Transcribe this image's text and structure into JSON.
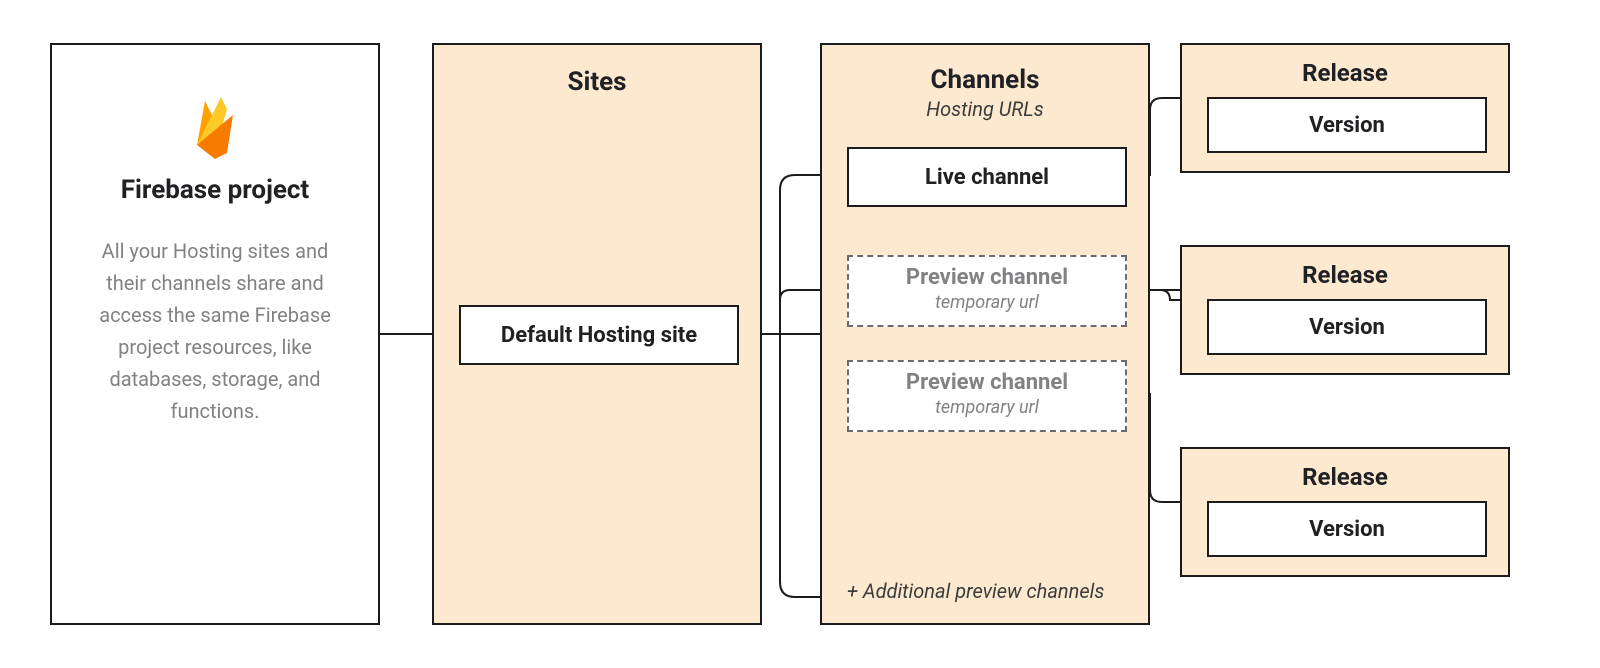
{
  "project": {
    "title": "Firebase project",
    "description": "All your Hosting sites and their channels share and access the same Firebase project resources, like databases, storage, and functions."
  },
  "sites": {
    "title": "Sites",
    "default_label": "Default Hosting site"
  },
  "channels": {
    "title": "Channels",
    "subtitle": "Hosting URLs",
    "live_label": "Live channel",
    "preview1_title": "Preview channel",
    "preview1_sub": "temporary url",
    "preview2_title": "Preview channel",
    "preview2_sub": "temporary url",
    "footer": "+ Additional preview channels"
  },
  "releases": {
    "r1_title": "Release",
    "r1_version": "Version",
    "r2_title": "Release",
    "r2_version": "Version",
    "r3_title": "Release",
    "r3_version": "Version"
  },
  "icons": {
    "firebase": "firebase-logo-icon"
  },
  "colors": {
    "peach": "#fde9cf",
    "border": "#1b1b1b",
    "muted": "#808285"
  }
}
